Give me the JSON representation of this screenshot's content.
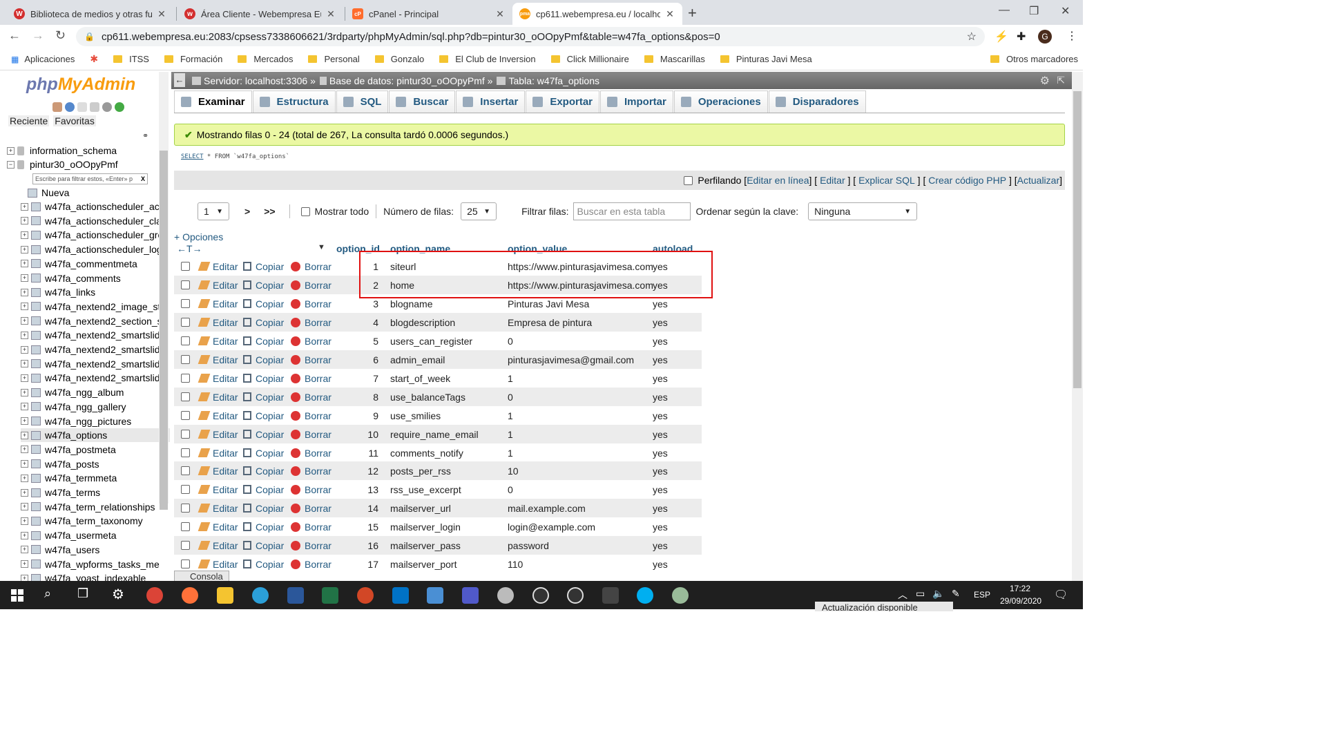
{
  "browser": {
    "tabs": [
      {
        "title": "Biblioteca de medios y otras func",
        "color": "#d32f2f",
        "glyph": "W",
        "active": false
      },
      {
        "title": "Área Cliente - Webempresa Europ",
        "color": "#d32f2f",
        "glyph": "w",
        "active": false
      },
      {
        "title": "cPanel - Principal",
        "color": "#ff6c2c",
        "glyph": "cP",
        "active": false
      },
      {
        "title": "cp611.webempresa.eu / localhost",
        "color": "#f89c0e",
        "glyph": "pma",
        "active": true
      }
    ],
    "url": "cp611.webempresa.eu:2083/cpsess7338606621/3rdparty/phpMyAdmin/sql.php?db=pintur30_oOOpyPmf&table=w47fa_options&pos=0",
    "profile_initial": "G",
    "bookmarks": [
      "Aplicaciones",
      "",
      "ITSS",
      "Formación",
      "Mercados",
      "Personal",
      "Gonzalo",
      "El Club de Inversion",
      "Click Millionaire",
      "Mascarillas",
      "Pinturas Javi Mesa"
    ],
    "other_bookmarks": "Otros marcadores"
  },
  "sidebar": {
    "logo_php": "php",
    "logo_myadmin": "MyAdmin",
    "tab_recent": "Reciente",
    "tab_favorites": "Favoritas",
    "filter_placeholder": "Escribe para filtrar estos, «Enter» p",
    "filter_clear": "X",
    "databases": [
      "information_schema",
      "pintur30_oOOpyPmf"
    ],
    "new_label": "Nueva",
    "tables": [
      "w47fa_actionscheduler_ac",
      "w47fa_actionscheduler_cla",
      "w47fa_actionscheduler_gro",
      "w47fa_actionscheduler_log",
      "w47fa_commentmeta",
      "w47fa_comments",
      "w47fa_links",
      "w47fa_nextend2_image_st",
      "w47fa_nextend2_section_s",
      "w47fa_nextend2_smartslid",
      "w47fa_nextend2_smartslid",
      "w47fa_nextend2_smartslid",
      "w47fa_nextend2_smartslid",
      "w47fa_ngg_album",
      "w47fa_ngg_gallery",
      "w47fa_ngg_pictures",
      "w47fa_options",
      "w47fa_postmeta",
      "w47fa_posts",
      "w47fa_termmeta",
      "w47fa_terms",
      "w47fa_term_relationships",
      "w47fa_term_taxonomy",
      "w47fa_usermeta",
      "w47fa_users",
      "w47fa_wpforms_tasks_me",
      "w47fa_yoast_indexable"
    ]
  },
  "breadcrumb": {
    "server": "Servidor: localhost:3306 »",
    "database": "Base de datos: pintur30_oOOpyPmf »",
    "table": "Tabla: w47fa_options"
  },
  "menu": [
    "Examinar",
    "Estructura",
    "SQL",
    "Buscar",
    "Insertar",
    "Exportar",
    "Importar",
    "Operaciones",
    "Disparadores"
  ],
  "success": "Mostrando filas 0 - 24 (total de 267, La consulta tardó 0.0006 segundos.)",
  "sql": {
    "select": "SELECT",
    "rest": " * FROM `w47fa_options`"
  },
  "profiling": {
    "label": "Perfilando",
    "links": [
      "Editar en línea",
      "Editar",
      "Explicar SQL",
      "Crear código PHP",
      "Actualizar"
    ]
  },
  "navigation": {
    "page": "1",
    "next": ">",
    "last": ">>",
    "show_all": "Mostrar todo",
    "rows_label": "Número de filas:",
    "rows_value": "25",
    "filter_label": "Filtrar filas:",
    "filter_placeholder": "Buscar en esta tabla",
    "sort_label": "Ordenar según la clave:",
    "sort_value": "Ninguna"
  },
  "options_link": "+ Opciones",
  "columns": [
    "option_id",
    "option_name",
    "option_value",
    "autoload"
  ],
  "actions": {
    "edit": "Editar",
    "copy": "Copiar",
    "delete": "Borrar"
  },
  "rows": [
    {
      "id": "1",
      "name": "siteurl",
      "value": "https://www.pinturasjavimesa.com",
      "autoload": "yes"
    },
    {
      "id": "2",
      "name": "home",
      "value": "https://www.pinturasjavimesa.com",
      "autoload": "yes"
    },
    {
      "id": "3",
      "name": "blogname",
      "value": "Pinturas Javi Mesa",
      "autoload": "yes"
    },
    {
      "id": "4",
      "name": "blogdescription",
      "value": "Empresa de pintura",
      "autoload": "yes"
    },
    {
      "id": "5",
      "name": "users_can_register",
      "value": "0",
      "autoload": "yes"
    },
    {
      "id": "6",
      "name": "admin_email",
      "value": "pinturasjavimesa@gmail.com",
      "autoload": "yes"
    },
    {
      "id": "7",
      "name": "start_of_week",
      "value": "1",
      "autoload": "yes"
    },
    {
      "id": "8",
      "name": "use_balanceTags",
      "value": "0",
      "autoload": "yes"
    },
    {
      "id": "9",
      "name": "use_smilies",
      "value": "1",
      "autoload": "yes"
    },
    {
      "id": "10",
      "name": "require_name_email",
      "value": "1",
      "autoload": "yes"
    },
    {
      "id": "11",
      "name": "comments_notify",
      "value": "1",
      "autoload": "yes"
    },
    {
      "id": "12",
      "name": "posts_per_rss",
      "value": "10",
      "autoload": "yes"
    },
    {
      "id": "13",
      "name": "rss_use_excerpt",
      "value": "0",
      "autoload": "yes"
    },
    {
      "id": "14",
      "name": "mailserver_url",
      "value": "mail.example.com",
      "autoload": "yes"
    },
    {
      "id": "15",
      "name": "mailserver_login",
      "value": "login@example.com",
      "autoload": "yes"
    },
    {
      "id": "16",
      "name": "mailserver_pass",
      "value": "password",
      "autoload": "yes"
    },
    {
      "id": "17",
      "name": "mailserver_port",
      "value": "110",
      "autoload": "yes"
    }
  ],
  "console": "Consola",
  "taskbar": {
    "lang": "ESP",
    "time": "17:22",
    "date": "29/09/2020",
    "toast": "Actualización disponible"
  }
}
